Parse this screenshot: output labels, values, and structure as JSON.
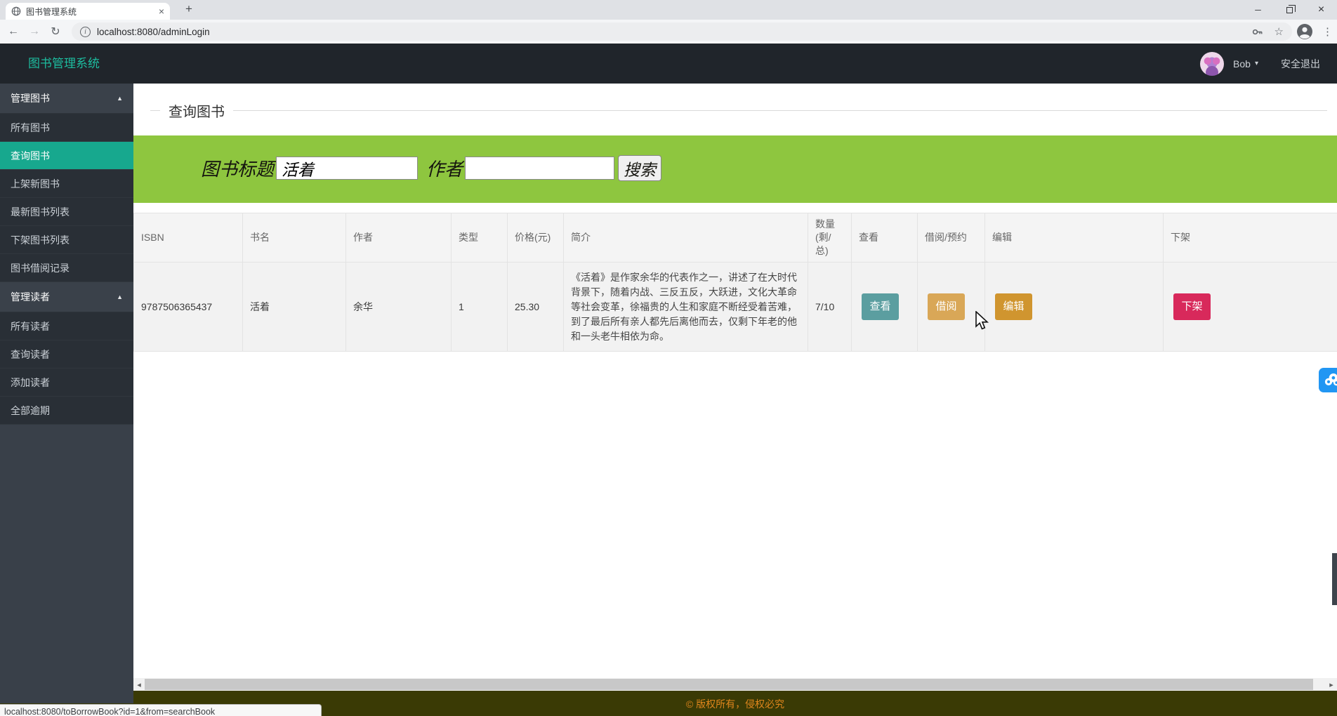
{
  "browser": {
    "tab_title": "图书管理系统",
    "url": "localhost:8080/adminLogin"
  },
  "icons": {
    "close": "×",
    "plus": "+",
    "back": "←",
    "forward": "→",
    "refresh": "↻",
    "menu_dots": "⋮",
    "star": "☆",
    "caret_down": "▾",
    "caret_up": "▲",
    "minimize": "─",
    "scroll_left": "◂",
    "scroll_right": "▸",
    "info": "i"
  },
  "navbar": {
    "brand": "图书管理系统",
    "username": "Bob",
    "logout": "安全退出"
  },
  "sidebar": {
    "sections": [
      {
        "label": "管理图书",
        "items": [
          "所有图书",
          "查询图书",
          "上架新图书",
          "最新图书列表",
          "下架图书列表",
          "图书借阅记录"
        ]
      },
      {
        "label": "管理读者",
        "items": [
          "所有读者",
          "查询读者",
          "添加读者",
          "全部逾期"
        ]
      }
    ],
    "active_item": "查询图书"
  },
  "page": {
    "title": "查询图书"
  },
  "search": {
    "title_label": "图书标题",
    "title_value": "活着",
    "author_label": "作者",
    "author_value": "",
    "button": "搜索"
  },
  "table": {
    "headers": [
      "ISBN",
      "书名",
      "作者",
      "类型",
      "价格(元)",
      "简介",
      "数量(剩/总)",
      "查看",
      "借阅/预约",
      "编辑",
      "下架"
    ],
    "row": {
      "isbn": "9787506365437",
      "title": "活着",
      "author": "余华",
      "type": "1",
      "price": "25.30",
      "summary": "《活着》是作家余华的代表作之一，讲述了在大时代背景下，随着内战、三反五反，大跃进，文化大革命等社会变革，徐福贵的人生和家庭不断经受着苦难，到了最后所有亲人都先后离他而去，仅剩下年老的他和一头老牛相依为命。",
      "quantity": "7/10",
      "view_btn": "查看",
      "borrow_btn": "借阅",
      "edit_btn": "编辑",
      "remove_btn": "下架"
    }
  },
  "footer": {
    "copyright": "© 版权所有，侵权必究"
  },
  "statusbar": {
    "link_url": "localhost:8080/toBorrowBook?id=1&from=searchBook"
  },
  "colors": {
    "accent_green": "#8ec63f",
    "brand_teal": "#1dbc9f",
    "active_item_teal": "#17a88e",
    "view_btn": "#5b9ea0",
    "borrow_btn": "#d9a757",
    "edit_btn": "#d0952f",
    "remove_btn": "#d8295b",
    "footer_bg": "#3a3a05",
    "footer_text": "#e0861c",
    "navbar_bg": "#20252b",
    "sidebar_bg": "#394049"
  }
}
